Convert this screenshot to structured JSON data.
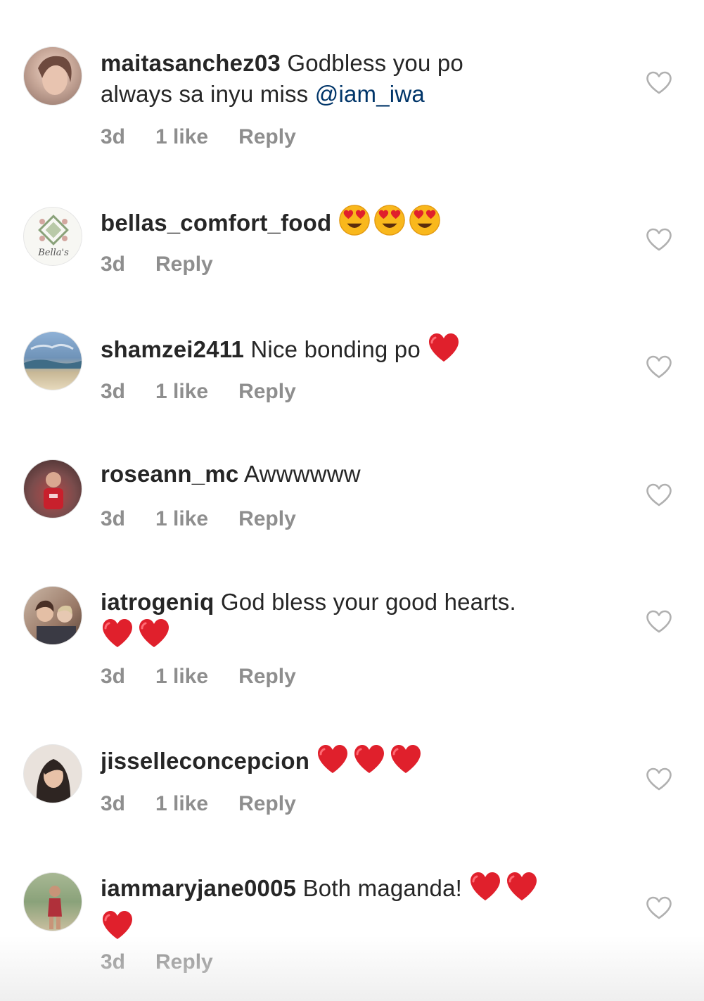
{
  "comments": [
    {
      "username": "maitasanchez03",
      "text_line1": " Godbless you po",
      "text_line2": "always sa inyu miss ",
      "mention": "@iam_iwa",
      "time": "3d",
      "likes": "1 like",
      "reply": "Reply",
      "avatar_color": "#c9a99a"
    },
    {
      "username": "bellas_comfort_food",
      "text": " ",
      "emoji": [
        "heart-eyes-emoji",
        "heart-eyes-emoji",
        "heart-eyes-emoji"
      ],
      "time": "3d",
      "reply": "Reply",
      "avatar_text": "Bella's",
      "avatar_color": "#f4f4f0"
    },
    {
      "username": "shamzei2411",
      "text": " Nice bonding po ",
      "emoji": [
        "red-heart-emoji"
      ],
      "time": "3d",
      "likes": "1 like",
      "reply": "Reply",
      "avatar_color": "#6f93b8"
    },
    {
      "username": "roseann_mc",
      "text": " Awwwwww",
      "time": "3d",
      "likes": "1 like",
      "reply": "Reply",
      "avatar_color": "#7a4c4c"
    },
    {
      "username": "iatrogeniq",
      "text": " God bless your good hearts.",
      "emoji": [
        "red-heart-emoji",
        "red-heart-emoji"
      ],
      "time": "3d",
      "likes": "1 like",
      "reply": "Reply",
      "avatar_color": "#9a7a68"
    },
    {
      "username": "jisselleconcepcion",
      "text": " ",
      "emoji": [
        "red-heart-emoji",
        "red-heart-emoji",
        "red-heart-emoji"
      ],
      "time": "3d",
      "likes": "1 like",
      "reply": "Reply",
      "avatar_color": "#3e3430"
    },
    {
      "username": "iammaryjane0005",
      "text": " Both maganda! ",
      "emoji": [
        "red-heart-emoji",
        "red-heart-emoji",
        "red-heart-emoji"
      ],
      "time": "3d",
      "reply": "Reply",
      "avatar_color": "#8aa27a"
    }
  ],
  "colors": {
    "text": "#262626",
    "meta": "#8e8e8e",
    "mention": "#003569",
    "heart_outline": "#b0b0b0",
    "emoji_red": "#e0202c"
  }
}
